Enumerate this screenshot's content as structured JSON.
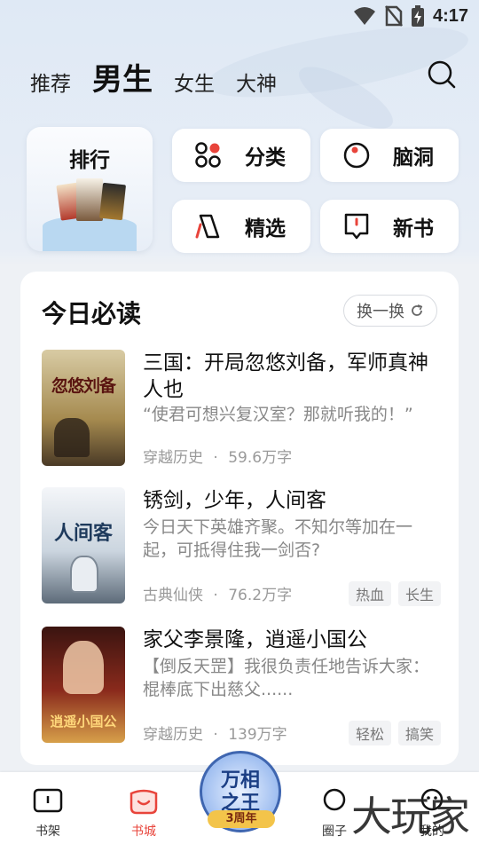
{
  "status": {
    "time": "4:17"
  },
  "tabs": [
    {
      "label": "推荐"
    },
    {
      "label": "男生"
    },
    {
      "label": "女生"
    },
    {
      "label": "大神"
    }
  ],
  "quick": {
    "rank_label": "排行",
    "buttons": [
      {
        "label": "分类",
        "icon": "category-icon"
      },
      {
        "label": "脑洞",
        "icon": "brainstorm-icon"
      },
      {
        "label": "精选",
        "icon": "featured-icon"
      },
      {
        "label": "新书",
        "icon": "new-book-icon"
      }
    ]
  },
  "daily": {
    "title": "今日必读",
    "refresh_label": "换一换",
    "books": [
      {
        "title": "三国：开局忽悠刘备，军师真神人也",
        "desc": "“使君可想兴复汉室？那就听我的！”",
        "genre": "穿越历史",
        "words": "59.6万字",
        "tags": [],
        "cover_text": "忽悠刘备"
      },
      {
        "title": "锈剑，少年，人间客",
        "desc": "今日天下英雄齐聚。不知尔等加在一起，可抵得住我一剑否?",
        "genre": "古典仙侠",
        "words": "76.2万字",
        "tags": [
          "热血",
          "长生"
        ],
        "cover_text": "人间客"
      },
      {
        "title": "家父李景隆，逍遥小国公",
        "desc": "【倒反天罡】我很负责任地告诉大家：棍棒底下出慈父......",
        "genre": "穿越历史",
        "words": "139万字",
        "tags": [
          "轻松",
          "搞笑"
        ],
        "cover_text": "逍遥小国公"
      }
    ],
    "meta_sep": "·"
  },
  "nav": {
    "items": [
      {
        "label": "书架"
      },
      {
        "label": "书城"
      },
      {
        "label": "圈子"
      },
      {
        "label": "我的"
      }
    ],
    "badge_line1": "万相",
    "badge_line2": "之王",
    "badge_line3": "3周年"
  },
  "watermark": "大玩家",
  "colors": {
    "accent": "#e8443b",
    "card": "#ffffff",
    "muted": "#9a9a9a"
  }
}
